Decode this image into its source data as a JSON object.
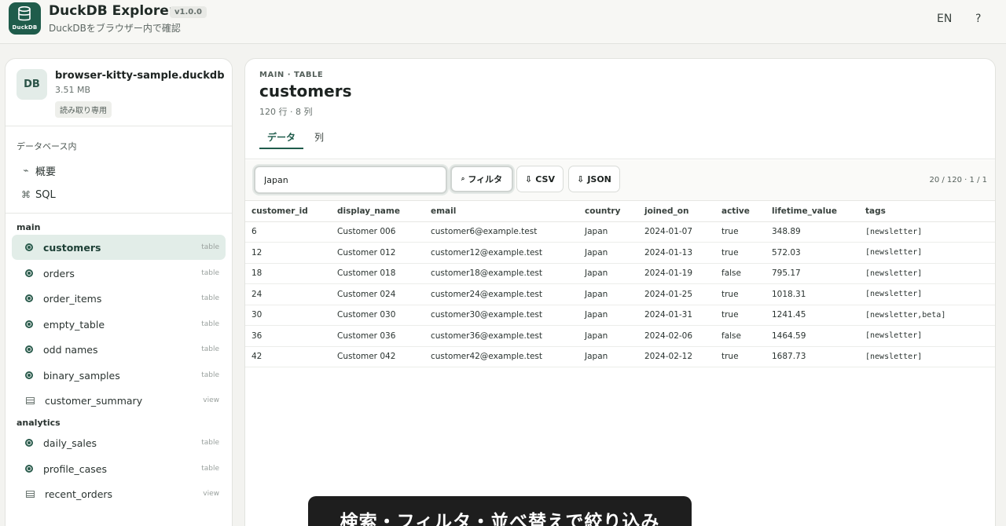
{
  "app": {
    "title": "DuckDB Explorer",
    "version": "v1.0.0",
    "subtitle": "DuckDBをブラウザー内で確認",
    "logo_text": "DuckDB",
    "lang": "EN",
    "help": "?"
  },
  "sidebar": {
    "db_avatar": "DB",
    "db_name": "browser-kitty-sample.duckdb",
    "db_size": "3.51 MB",
    "db_badge": "読み取り専用",
    "section_in_db": "データベース内",
    "nav": [
      {
        "label": "概要",
        "icon": "overview-icon"
      },
      {
        "label": "SQL",
        "icon": "command-icon"
      }
    ],
    "schemas": [
      {
        "name": "main",
        "items": [
          {
            "label": "customers",
            "kind": "table",
            "active": true
          },
          {
            "label": "orders",
            "kind": "table"
          },
          {
            "label": "order_items",
            "kind": "table"
          },
          {
            "label": "empty_table",
            "kind": "table"
          },
          {
            "label": "odd names",
            "kind": "table"
          },
          {
            "label": "binary_samples",
            "kind": "table"
          },
          {
            "label": "customer_summary",
            "kind": "view"
          }
        ]
      },
      {
        "name": "analytics",
        "items": [
          {
            "label": "daily_sales",
            "kind": "table"
          },
          {
            "label": "profile_cases",
            "kind": "table"
          },
          {
            "label": "recent_orders",
            "kind": "view"
          }
        ]
      }
    ]
  },
  "main": {
    "crumb": "MAIN · TABLE",
    "title": "customers",
    "meta": "120 行 · 8 列",
    "tabs": [
      {
        "label": "データ",
        "active": true
      },
      {
        "label": "列"
      }
    ],
    "toolbar": {
      "filter_value": "Japan",
      "filter_button": "フィルタ",
      "csv_button": "CSV",
      "json_button": "JSON",
      "pager": "20 / 120 · 1 / 1"
    },
    "columns": [
      "customer_id",
      "display_name",
      "email",
      "country",
      "joined_on",
      "active",
      "lifetime_value",
      "tags"
    ],
    "rows": [
      [
        "6",
        "Customer 006",
        "customer6@example.test",
        "Japan",
        "2024-01-07",
        "true",
        "348.89",
        "[newsletter]"
      ],
      [
        "12",
        "Customer 012",
        "customer12@example.test",
        "Japan",
        "2024-01-13",
        "true",
        "572.03",
        "[newsletter]"
      ],
      [
        "18",
        "Customer 018",
        "customer18@example.test",
        "Japan",
        "2024-01-19",
        "false",
        "795.17",
        "[newsletter]"
      ],
      [
        "24",
        "Customer 024",
        "customer24@example.test",
        "Japan",
        "2024-01-25",
        "true",
        "1018.31",
        "[newsletter]"
      ],
      [
        "30",
        "Customer 030",
        "customer30@example.test",
        "Japan",
        "2024-01-31",
        "true",
        "1241.45",
        "[newsletter,beta]"
      ],
      [
        "36",
        "Customer 036",
        "customer36@example.test",
        "Japan",
        "2024-02-06",
        "false",
        "1464.59",
        "[newsletter]"
      ],
      [
        "42",
        "Customer 042",
        "customer42@example.test",
        "Japan",
        "2024-02-12",
        "true",
        "1687.73",
        "[newsletter]"
      ]
    ]
  },
  "caption": "検索・フィルタ・並べ替えで絞り込み"
}
